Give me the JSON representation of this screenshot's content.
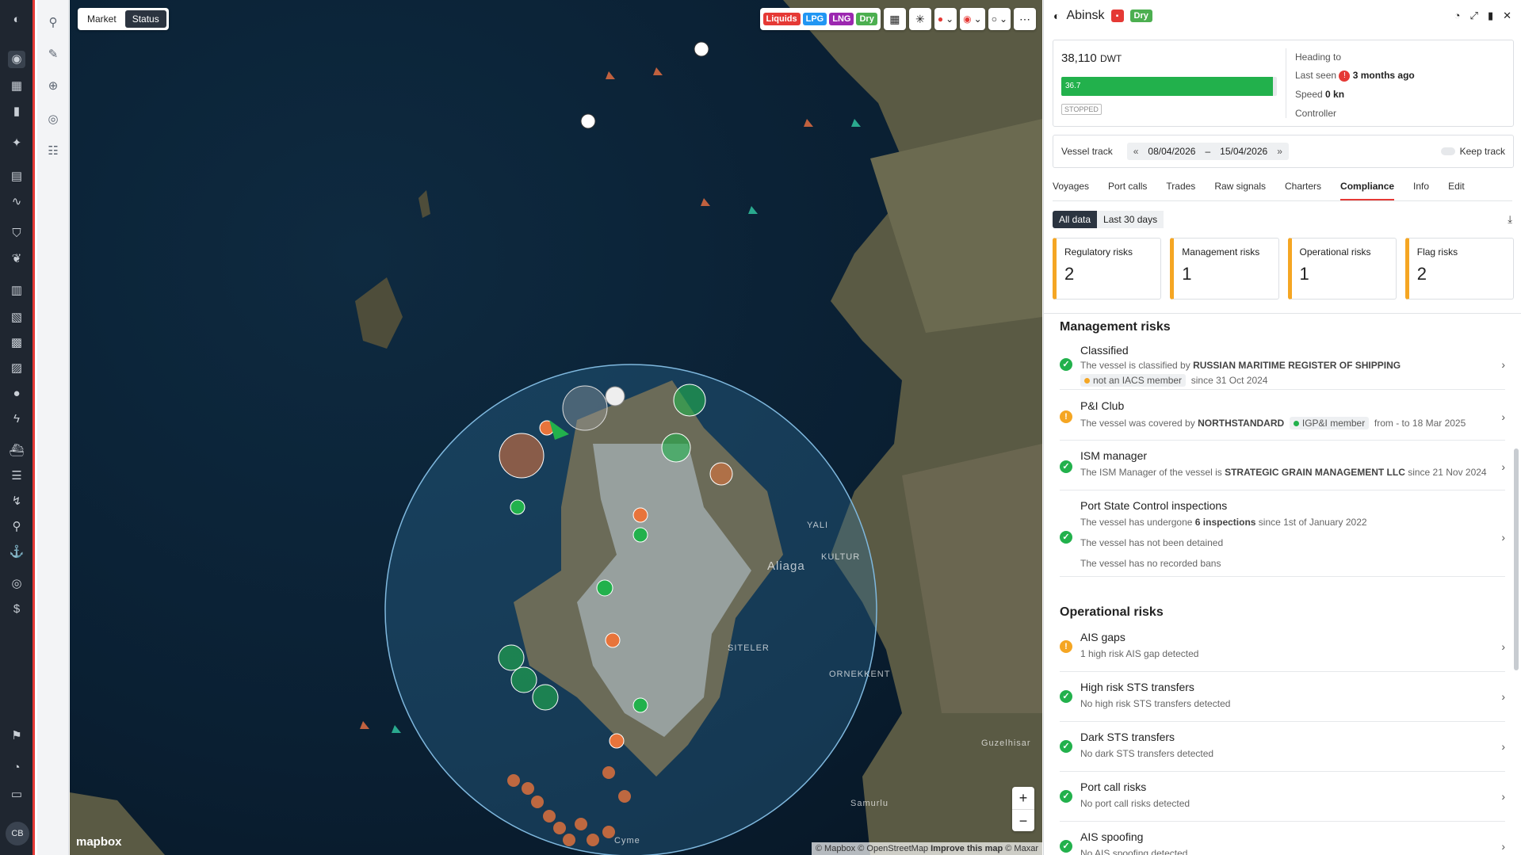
{
  "map": {
    "toggle": [
      "Market",
      "Status"
    ],
    "active_toggle": "Status",
    "chips": [
      {
        "label": "Liquids",
        "color": "#e53935"
      },
      {
        "label": "LPG",
        "color": "#2196f3"
      },
      {
        "label": "LNG",
        "color": "#9c27b0"
      },
      {
        "label": "Dry",
        "color": "#4caf50"
      }
    ],
    "place_labels": [
      "YALI",
      "KULTUR",
      "Aliaga",
      "SITELER",
      "ORNEKKENT",
      "Guzelhisar",
      "Samurlu",
      "Cyme"
    ],
    "logo": "mapbox",
    "attribution": {
      "mapbox": "© Mapbox",
      "osm": "© OpenStreetMap",
      "improve": "Improve this map",
      "maxar": "© Maxar"
    },
    "zoom_in": "+",
    "zoom_out": "−"
  },
  "panel": {
    "vessel_name": "Abinsk",
    "category": "Dry",
    "dwt": "38,110",
    "dwt_unit": "DWT",
    "draught": "36.7",
    "draught_fraction": 0.98,
    "status": "STOPPED",
    "heading_to_label": "Heading to",
    "last_seen_label": "Last seen",
    "last_seen_value": "3 months ago",
    "speed_label": "Speed",
    "speed_value": "0 kn",
    "controller_label": "Controller",
    "track_label": "Vessel track",
    "date_from": "08/04/2026",
    "date_sep": "–",
    "date_to": "15/04/2026",
    "keep_track": "Keep track",
    "tabs": [
      "Voyages",
      "Port calls",
      "Trades",
      "Raw signals",
      "Charters",
      "Compliance",
      "Info",
      "Edit"
    ],
    "active_tab": "Compliance",
    "segments": [
      "All data",
      "Last 30 days"
    ],
    "risk_cards": [
      {
        "label": "Regulatory risks",
        "value": "2"
      },
      {
        "label": "Management risks",
        "value": "1"
      },
      {
        "label": "Operational risks",
        "value": "1"
      },
      {
        "label": "Flag risks",
        "value": "2"
      }
    ],
    "management_title": "Management risks",
    "management": [
      {
        "title": "Classified",
        "status": "ok",
        "line1_a": "The vessel is classified by ",
        "line1_b": "RUSSIAN MARITIME REGISTER OF SHIPPING",
        "tag": "not an IACS member",
        "tag_color": "#f5a623",
        "tag_suffix": "since 31 Oct 2024"
      },
      {
        "title": "P&I Club",
        "status": "warn",
        "line1_a": "The vessel was covered by ",
        "line1_b": "NORTHSTANDARD",
        "tag": "IGP&I member",
        "tag_color": "#22b14c",
        "tag_suffix": "from - to 18 Mar 2025"
      },
      {
        "title": "ISM manager",
        "status": "ok",
        "line1_a": "The ISM Manager of the vessel is ",
        "line1_b": "STRATEGIC GRAIN MANAGEMENT LLC",
        "line1_c": " since 21 Nov 2024"
      },
      {
        "title": "Port State Control inspections",
        "status": "ok",
        "line1_a": "The vessel has undergone ",
        "line1_b": "6 inspections",
        "line1_c": " since 1st of January 2022",
        "line2": "The vessel has not been detained",
        "line3": "The vessel has no recorded bans"
      }
    ],
    "operational_title": "Operational risks",
    "operational": [
      {
        "title": "AIS gaps",
        "status": "warn",
        "desc": "1 high risk AIS gap detected"
      },
      {
        "title": "High risk STS transfers",
        "status": "ok",
        "desc": "No high risk STS transfers detected"
      },
      {
        "title": "Dark STS transfers",
        "status": "ok",
        "desc": "No dark STS transfers detected"
      },
      {
        "title": "Port call risks",
        "status": "ok",
        "desc": "No port call risks detected"
      },
      {
        "title": "AIS spoofing",
        "status": "ok",
        "desc": "No AIS spoofing detected"
      }
    ]
  },
  "user": {
    "initials": "CB"
  },
  "colors": {
    "accent": "#e53935",
    "ok": "#22b14c",
    "warn": "#f5a623",
    "rail": "#1f2630"
  }
}
